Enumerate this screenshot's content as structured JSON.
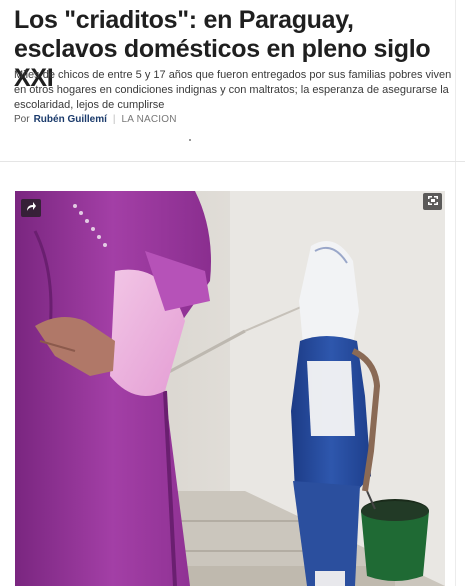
{
  "article": {
    "headline": "Los \"criaditos\": en Paraguay, esclavos domésticos en pleno siglo XXI",
    "summary": "Miles de chicos de entre 5 y 17 años que fueron entregados por sus familias pobres viven en otros hogares en condiciones indignas y con maltratos; la esperanza de asegurarse la escolaridad, lejos de cumplirse",
    "byline": {
      "prefix": "Por",
      "author": "Rubén Guillemí",
      "separator": "|",
      "source": "LA NACION"
    }
  },
  "photo": {
    "share_icon": "share-arrow-icon",
    "expand_icon": "fullscreen-expand-icon"
  },
  "colors": {
    "author_link": "#1a3a6b",
    "headline": "#1f1f1f"
  }
}
